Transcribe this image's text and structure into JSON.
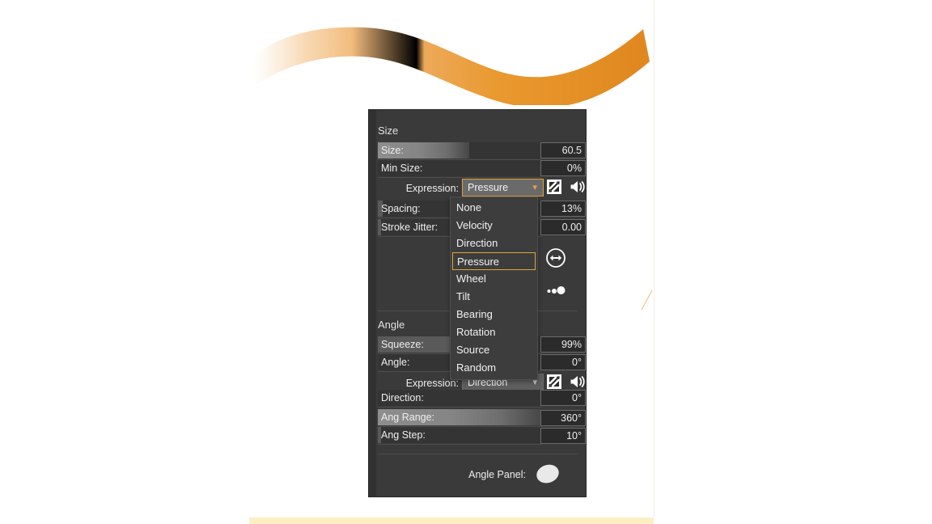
{
  "canvas": {
    "artwork_name": "orange-brush-stroke",
    "stroke_color": "#e8912d",
    "stroke_tail_color": "#f6d7b0",
    "bottom_bar_color": "#fdeec4",
    "background": "#ffffff"
  },
  "panel": {
    "background": "#3a3a3a",
    "accent": "#e2a23c",
    "groups": [
      {
        "title": "Size"
      },
      {
        "title": "Angle"
      }
    ],
    "size_group": {
      "title": "Size",
      "rows": [
        {
          "label": "Size:",
          "value": "60.5",
          "fill": 0.56,
          "gradient": true
        },
        {
          "label": "Min Size:",
          "value": "0%",
          "fill": 0.0,
          "gradient": false
        },
        {
          "label": "Spacing:",
          "value": "13%",
          "fill": 0.02,
          "gradient": false
        },
        {
          "label": "Stroke Jitter:",
          "value": "0.00",
          "fill": 0.0,
          "gradient": false
        }
      ],
      "expression_label": "Expression:",
      "expression_value": "Pressure"
    },
    "angle_group": {
      "title": "Angle",
      "rows": [
        {
          "label": "Squeeze:",
          "value": "99%",
          "fill": 0.56,
          "gradient": false
        },
        {
          "label": "Angle:",
          "value": "0°",
          "fill": 0.0,
          "gradient": false
        },
        {
          "label": "Direction:",
          "value": "0°",
          "fill": 0.0,
          "gradient": false
        },
        {
          "label": "Ang Range:",
          "value": "360°",
          "fill": 1.0,
          "gradient": true
        },
        {
          "label": "Ang Step:",
          "value": "10°",
          "fill": 0.015,
          "gradient": false
        }
      ],
      "expression_label": "Expression:",
      "expression_value": "Direction"
    },
    "angle_panel_label": "Angle Panel:",
    "icons": {
      "invert": "invert-expression-icon",
      "curve": "pressure-curve-icon",
      "flip": "flip-direction-icon",
      "taper": "taper-dots-icon",
      "angle_preview": "angle-panel-ellipse-icon",
      "chevron": "⌄"
    }
  },
  "dropdown": {
    "name": "expression-dropdown",
    "selected": "Pressure",
    "items": [
      "None",
      "Velocity",
      "Direction",
      "Pressure",
      "Wheel",
      "Tilt",
      "Bearing",
      "Rotation",
      "Source",
      "Random"
    ]
  }
}
